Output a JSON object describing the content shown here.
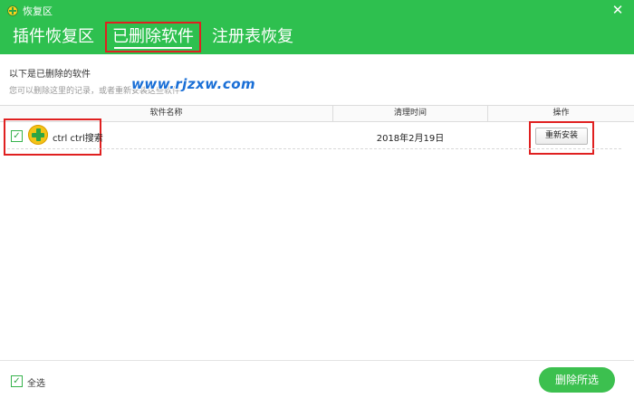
{
  "window": {
    "title": "恢复区",
    "close_icon": "close-icon"
  },
  "tabs": [
    {
      "label": "插件恢复区",
      "active": false
    },
    {
      "label": "已删除软件",
      "active": true
    },
    {
      "label": "注册表恢复",
      "active": false
    }
  ],
  "info": {
    "title": "以下是已删除的软件",
    "description": "您可以删除这里的记录，或者重新安装这些软件"
  },
  "watermark": "www.rjzxw.com",
  "table": {
    "columns": [
      "软件名称",
      "清理时间",
      "操作"
    ],
    "rows": [
      {
        "checked": true,
        "name": "ctrl ctrl搜索",
        "time": "2018年2月19日",
        "action": "重新安装"
      }
    ]
  },
  "footer": {
    "select_all_label": "全选",
    "select_all_checked": true,
    "delete_button": "删除所选"
  },
  "colors": {
    "header": "#2ec04f",
    "highlight": "#e02020",
    "button": "#3cc04f"
  }
}
